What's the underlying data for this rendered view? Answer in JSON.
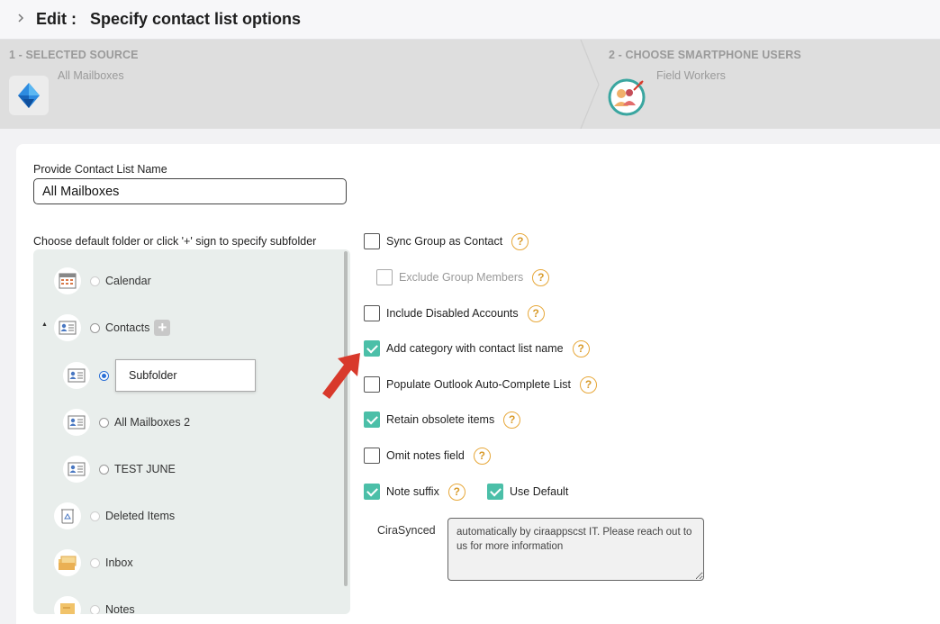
{
  "header": {
    "title": "Edit :   Specify contact list options"
  },
  "steps": [
    {
      "title": "1 - SELECTED SOURCE",
      "subtitle": "All Mailboxes",
      "icon": "azure-icon"
    },
    {
      "title": "2 - CHOOSE SMARTPHONE USERS",
      "subtitle": "Field Workers",
      "icon": "users-target-icon"
    }
  ],
  "form": {
    "name_label": "Provide Contact List Name",
    "name_value": "All Mailboxes",
    "folder_label": "Choose default folder or click '+' sign to specify subfolder"
  },
  "tree": {
    "items": [
      {
        "label": "Calendar",
        "icon": "calendar-icon"
      },
      {
        "label": "Contacts",
        "icon": "contact-card-icon",
        "add": "+"
      },
      {
        "label": "",
        "icon": "contact-card-icon",
        "input_value": "Subfolder"
      },
      {
        "label": "All Mailboxes 2",
        "icon": "contact-card-icon"
      },
      {
        "label": "TEST JUNE",
        "icon": "contact-card-icon"
      },
      {
        "label": "Deleted Items",
        "icon": "trash-icon"
      },
      {
        "label": "Inbox",
        "icon": "inbox-icon"
      },
      {
        "label": "Notes",
        "icon": "notes-icon"
      }
    ]
  },
  "options": [
    {
      "label": "Sync Group as Contact",
      "checked": false
    },
    {
      "label": "Exclude Group Members",
      "checked": false,
      "disabled": true
    },
    {
      "label": "Include Disabled Accounts",
      "checked": false
    },
    {
      "label": "Add category with contact list name",
      "checked": true
    },
    {
      "label": "Populate Outlook Auto-Complete List",
      "checked": false
    },
    {
      "label": "Retain obsolete items",
      "checked": true
    },
    {
      "label": "Omit notes field",
      "checked": false
    },
    {
      "label": "Note suffix",
      "checked": true
    },
    {
      "label": "Use Default",
      "checked": true
    }
  ],
  "help_glyph": "?",
  "note_suffix": {
    "label": "CiraSynced",
    "value": "automatically by ciraappscst IT. Please reach out to us for more information"
  },
  "colors": {
    "accent": "#4bbfa8",
    "help": "#e7a83a",
    "arrow": "#d8392b"
  }
}
